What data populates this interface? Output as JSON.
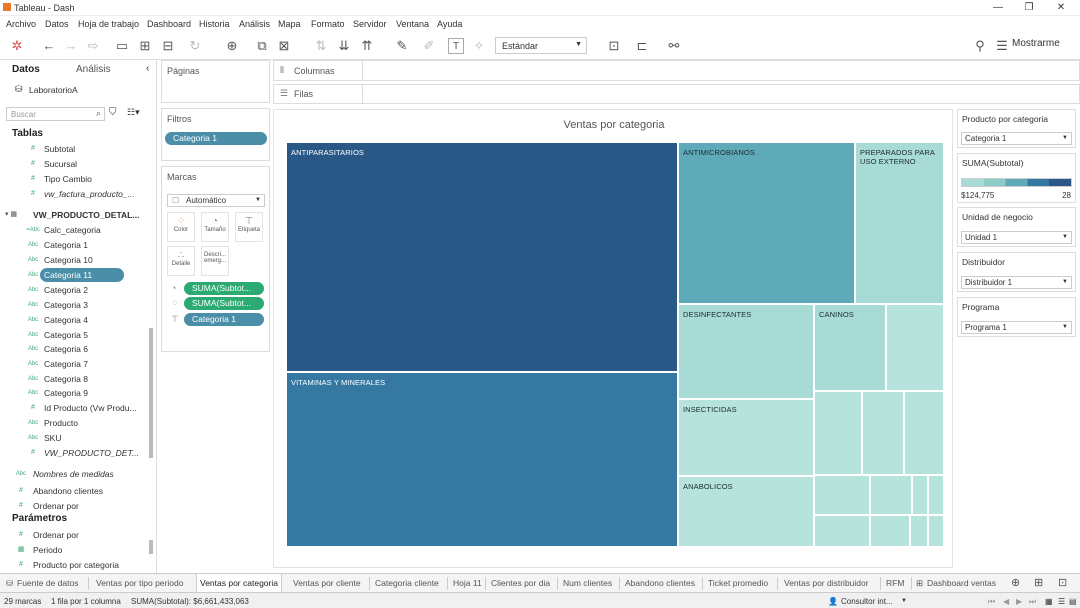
{
  "window": {
    "title": "Tableau - Dash"
  },
  "menu": [
    "Archivo",
    "Datos",
    "Hoja de trabajo",
    "Dashboard",
    "Historia",
    "Análisis",
    "Mapa",
    "Formato",
    "Servidor",
    "Ventana",
    "Ayuda"
  ],
  "toolbar": {
    "fit": "Estándar",
    "show_me": "Mostrarme"
  },
  "left": {
    "tab_datos": "Datos",
    "tab_analisis": "Análisis",
    "datasource": "LaboratorioA",
    "search_placeholder": "Buscar",
    "tablas": "Tablas",
    "fields": [
      {
        "icon": "#",
        "label": "Subtotal"
      },
      {
        "icon": "#",
        "label": "Sucursal"
      },
      {
        "icon": "#",
        "label": "Tipo Cambio"
      },
      {
        "icon": "#",
        "label": "vw_factura_producto_..."
      },
      {
        "icon": "",
        "label": "VW_PRODUCTO_DETAL..."
      },
      {
        "icon": "=Abc",
        "label": "Calc_categoria"
      },
      {
        "icon": "Abc",
        "label": "Categoria 1"
      },
      {
        "icon": "Abc",
        "label": "Categoria 10"
      },
      {
        "icon": "Abc",
        "label": "Categoria 11"
      },
      {
        "icon": "Abc",
        "label": "Categoria 2"
      },
      {
        "icon": "Abc",
        "label": "Categoria 3"
      },
      {
        "icon": "Abc",
        "label": "Categoria 4"
      },
      {
        "icon": "Abc",
        "label": "Categoria 5"
      },
      {
        "icon": "Abc",
        "label": "Categoria 6"
      },
      {
        "icon": "Abc",
        "label": "Categoria 7"
      },
      {
        "icon": "Abc",
        "label": "Categoria 8"
      },
      {
        "icon": "Abc",
        "label": "Categoria 9"
      },
      {
        "icon": "#",
        "label": "Id Producto (Vw Produ..."
      },
      {
        "icon": "Abc",
        "label": "Producto"
      },
      {
        "icon": "Abc",
        "label": "SKU"
      },
      {
        "icon": "#",
        "label": "VW_PRODUCTO_DET..."
      },
      {
        "icon": "Abc",
        "label": "Nombres de medidas"
      },
      {
        "icon": "#",
        "label": "Abandono clientes"
      },
      {
        "icon": "#",
        "label": "Ordenar por"
      }
    ],
    "parametros": "Parámetros",
    "params": [
      {
        "icon": "#",
        "label": "Ordenar por"
      },
      {
        "icon": "▦",
        "label": "Periodo"
      },
      {
        "icon": "#",
        "label": "Producto por categoria"
      }
    ]
  },
  "shelves": {
    "paginas": "Páginas",
    "filtros": "Filtros",
    "filter_pill": "Categoria 1",
    "marcas": "Marcas",
    "mark_type": "Automático",
    "mark_buttons": [
      "Color",
      "Tamaño",
      "Etiqueta",
      "Detalle",
      "Descri... emerg..."
    ],
    "mark_pills": [
      "SUMA(Subtot...",
      "SUMA(Subtot...",
      "Categoria 1"
    ],
    "columnas": "Columnas",
    "filas": "Filas"
  },
  "view": {
    "title": "Ventas por categoria"
  },
  "chart_data": {
    "type": "heatmap",
    "title": "Ventas por categoria",
    "categories": [
      "ANTIPARASITARIOS",
      "VITAMINAS Y MINERALES",
      "ANTIMICROBIANOS",
      "PREPARADOS PARA USO EXTERNO",
      "DESINFECTANTES",
      "CANINOS",
      "INSECTICIDAS",
      "ANABOLICOS"
    ],
    "color_legend": {
      "measure": "SUMA(Subtotal)",
      "min": "$124,775",
      "max": "28"
    }
  },
  "right": {
    "cards": [
      {
        "title": "Producto por categoria",
        "value": "Categoria 1"
      },
      {
        "title": "SUMA(Subtotal)",
        "min": "$124,775",
        "max": "28"
      },
      {
        "title": "Unidad de negocio",
        "value": "Unidad 1"
      },
      {
        "title": "Distribuidor",
        "value": "Distribuidor 1"
      },
      {
        "title": "Programa",
        "value": "Programa 1"
      }
    ]
  },
  "sheet_tabs": [
    "Fuente de datos",
    "Ventas por tipo periodo",
    "Ventas por categoria",
    "Ventas por cliente",
    "Categoria cliente",
    "Hoja 11",
    "Clientes por dia",
    "Num clientes",
    "Abandono clientes",
    "Ticket promedio",
    "Ventas por distribuidor",
    "RFM",
    "Dashboard ventas"
  ],
  "status": {
    "marks": "29 marcas",
    "rows": "1 fila por 1 columna",
    "sum": "SUMA(Subtotal): $6,661,433,063",
    "user": "Consultor int..."
  },
  "colors": {
    "dark": "#295887",
    "mid": "#3579a3",
    "light": "#a8dbd5",
    "lighter": "#b6e3dc",
    "pill_blue": "#4a8ea8",
    "pill_green": "#2bab72"
  }
}
